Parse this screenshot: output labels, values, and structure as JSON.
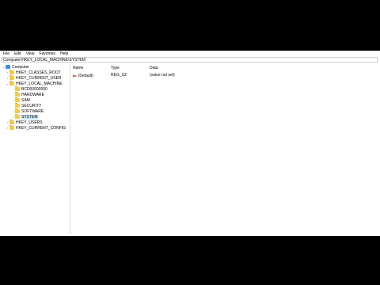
{
  "menu": [
    "File",
    "Edit",
    "View",
    "Favorites",
    "Help"
  ],
  "address": "Computer\\HKEY_LOCAL_MACHINE\\SYSTEM",
  "tree": {
    "root": "Computer",
    "items": [
      "HKEY_CLASSES_ROOT",
      "HKEY_CURRENT_USER",
      "HKEY_LOCAL_MACHINE",
      "BCD00000000",
      "HARDWARE",
      "SAM",
      "SECURITY",
      "SOFTWARE",
      "SYSTEM",
      "HKEY_USERS",
      "HKEY_CURRENT_CONFIG"
    ]
  },
  "columns": {
    "name": "Name",
    "type": "Type",
    "data": "Data"
  },
  "values": [
    {
      "icon": "ab",
      "name": "(Default)",
      "type": "REG_SZ",
      "data": "(value not set)"
    }
  ]
}
